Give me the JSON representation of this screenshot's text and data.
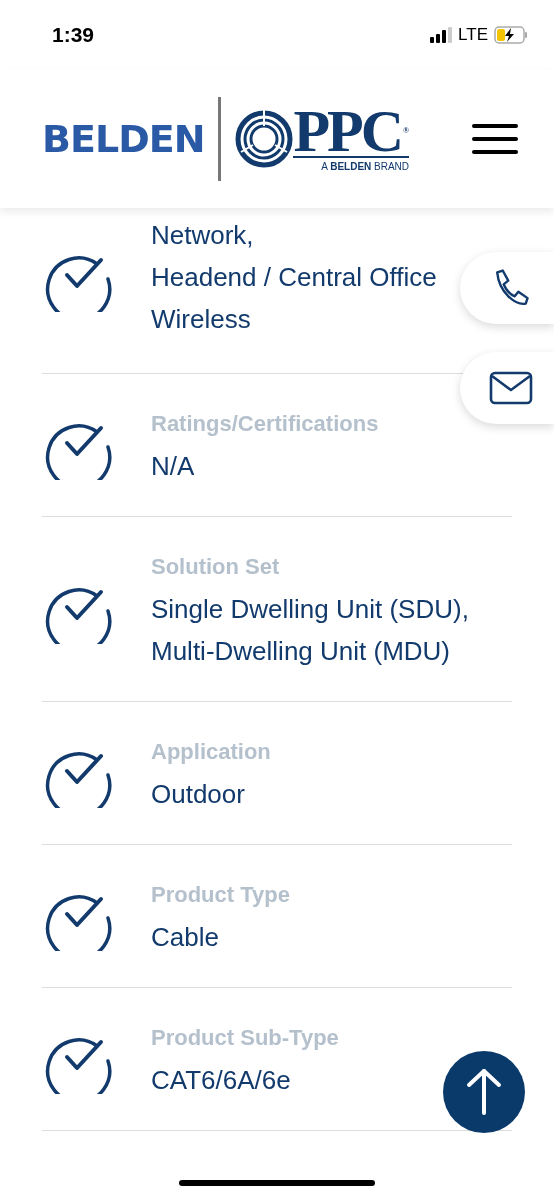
{
  "status_bar": {
    "time": "1:39",
    "network": "LTE"
  },
  "header": {
    "logo": {
      "brand": "BELDEN",
      "mark": "PPC",
      "registered": "®",
      "tagline_prefix": "A ",
      "tagline_brand": "BELDEN",
      "tagline_suffix": " BRAND"
    }
  },
  "specs": [
    {
      "value_lines": [
        "Network,",
        "Headend / Central Office",
        "Wireless"
      ]
    },
    {
      "label": "Ratings/Certifications",
      "value_lines": [
        "N/A"
      ]
    },
    {
      "label": "Solution Set",
      "value_lines": [
        "Single Dwelling Unit (SDU),",
        "Multi-Dwelling Unit (MDU)"
      ]
    },
    {
      "label": "Application",
      "value_lines": [
        "Outdoor"
      ]
    },
    {
      "label": "Product Type",
      "value_lines": [
        "Cable"
      ]
    },
    {
      "label": "Product Sub-Type",
      "value_lines": [
        "CAT6/6A/6e"
      ]
    }
  ],
  "floating_actions": [
    {
      "kind": "phone"
    },
    {
      "kind": "mail"
    }
  ]
}
